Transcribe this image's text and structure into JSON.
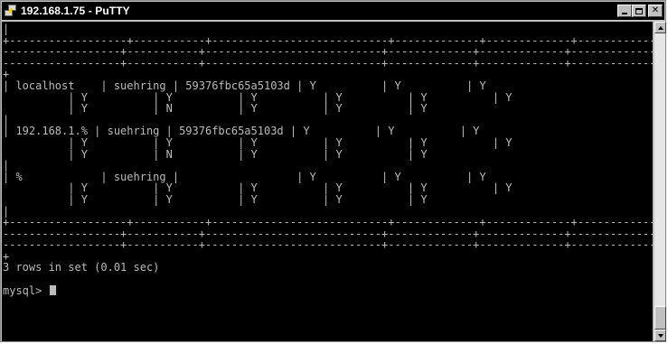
{
  "window": {
    "title": "192.168.1.75 - PuTTY",
    "icon": "putty-icon",
    "controls": {
      "minimize_icon": "minimize-icon",
      "maximize_icon": "maximize-icon",
      "close_label": "✕"
    }
  },
  "terminal": {
    "colors": {
      "background": "#000000",
      "text": "#bbbbbb"
    },
    "lines": [
      "|",
      "+------------------+-----------+---------------------------+-------------+-------------+-------------+-----",
      "------------------+-----------+---------------------------+-------------+-------------+-------------+-----",
      "------------------+-----------+---------------------------+-------------+-------------+-------------+-----",
      "+",
      "| localhost    | suehring | 59376fbc65a5103d | Y          | Y          | Y",
      "          | Y          | Y          | Y          | Y          | Y          | Y",
      "          | Y          | N          | Y          | Y          | Y",
      "|",
      "| 192.168.1.% | suehring | 59376fbc65a5103d | Y          | Y          | Y",
      "          | Y          | Y          | Y          | Y          | Y          | Y",
      "          | Y          | N          | Y          | Y          | Y",
      "|",
      "| %            | suehring |                  | Y          | Y          | Y",
      "          | Y          | Y          | Y          | Y          | Y          | Y",
      "          | Y          | Y          | Y          | Y          | Y",
      "|",
      "+------------------+-----------+---------------------------+-------------+-------------+-------------+-----",
      "------------------+-----------+---------------------------+-------------+-------------+-------------+-----",
      "------------------+-----------+---------------------------+-------------+-------------+-------------+-----",
      "+",
      "3 rows in set (0.01 sec)",
      ""
    ],
    "prompt": "mysql> "
  },
  "scrollbar": {
    "up_icon": "scroll-up-arrow-icon",
    "down_icon": "scroll-down-arrow-icon"
  }
}
